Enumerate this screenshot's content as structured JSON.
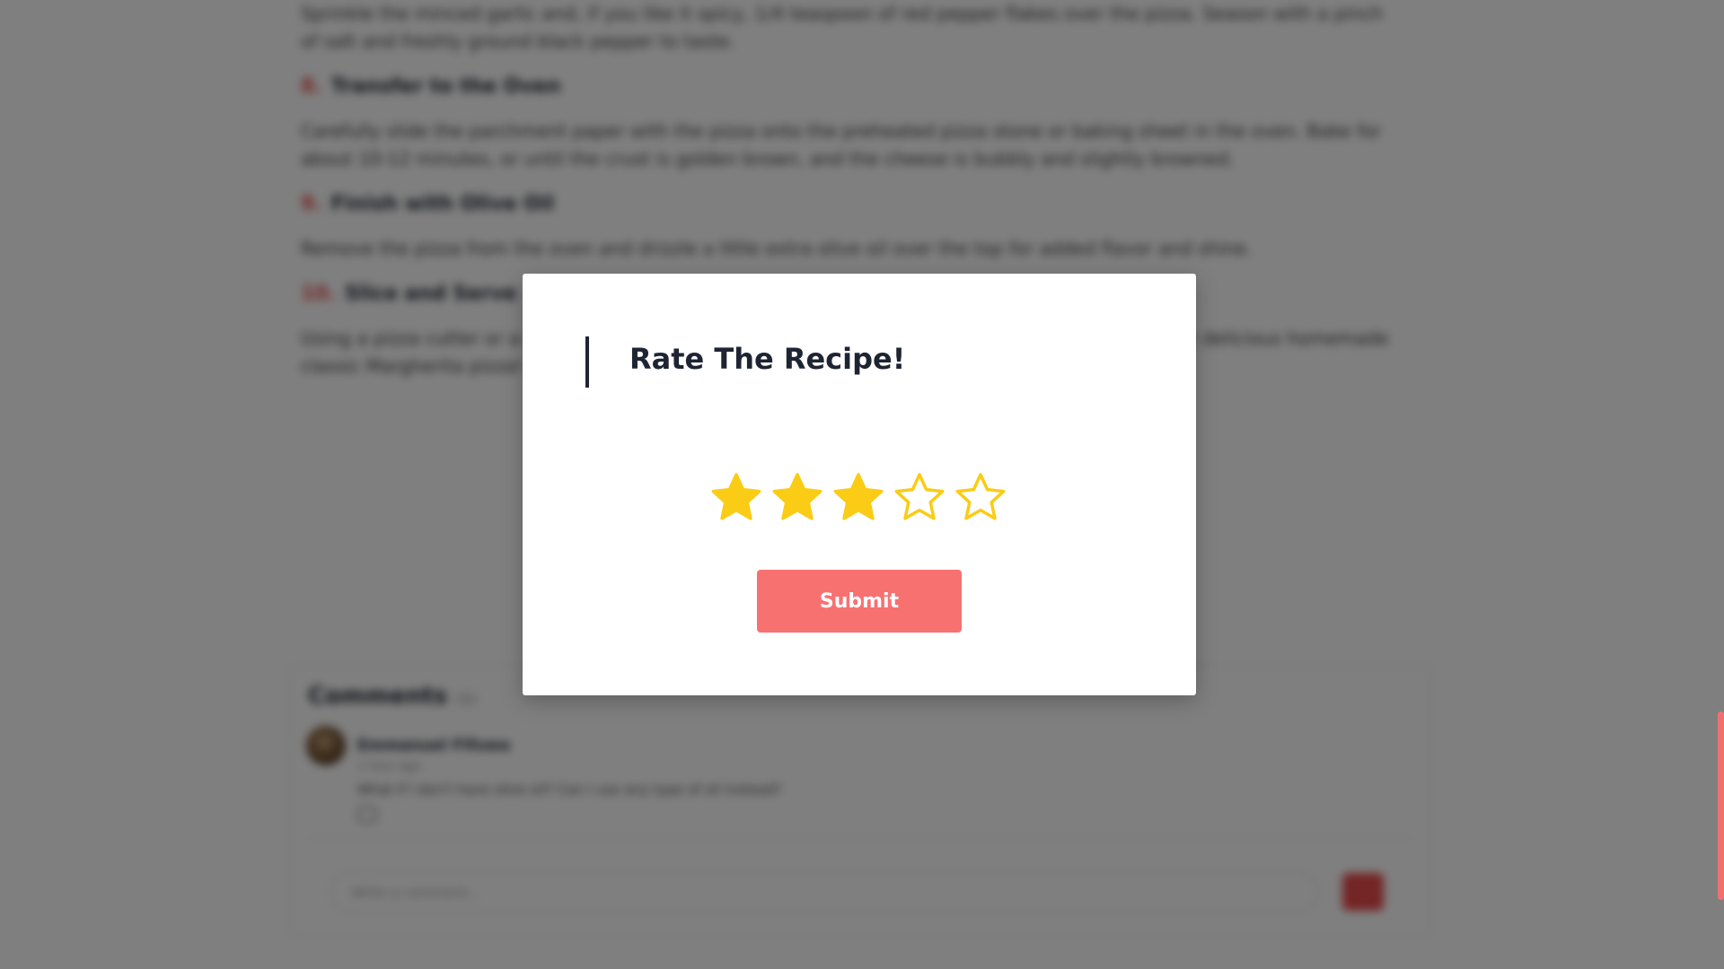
{
  "article": {
    "paragraphs": [
      {
        "type": "text",
        "text": "Sprinkle the minced garlic and, if you like it spicy, 1/4 teaspoon of red pepper flakes over the pizza. Season with a pinch of salt and freshly ground black pepper to taste."
      },
      {
        "type": "step",
        "num": "8.",
        "title": "Transfer to the Oven"
      },
      {
        "type": "text",
        "text": "Carefully slide the parchment paper with the pizza onto the preheated pizza stone or baking sheet in the oven. Bake for about 10-12 minutes, or until the crust is golden brown, and the cheese is bubbly and slightly browned."
      },
      {
        "type": "step",
        "num": "9.",
        "title": "Finish with Olive Oil"
      },
      {
        "type": "text",
        "text": "Remove the pizza from the oven and drizzle a little extra olive oil over the top for added flavor and shine."
      },
      {
        "type": "step",
        "num": "10.",
        "title": "Slice and Serve"
      },
      {
        "type": "text",
        "text": "Using a pizza cutter or a sharp knife, slice the pizza into wedges and serve immediately. Enjoy your delicious homemade classic Margherita pizza!"
      }
    ]
  },
  "comments": {
    "title": "Comments",
    "count": "(1)",
    "items": [
      {
        "name": "Emmanuel Fifuwa",
        "time": "1 hour ago",
        "text": "What if I don't have olive oil? Can I use any type of oil instead?"
      }
    ],
    "input_placeholder": "Write a comment..."
  },
  "modal": {
    "title": "Rate The Recipe!",
    "rating": 3,
    "max_rating": 5,
    "submit_label": "Submit",
    "star_color": "#FACC15",
    "submit_color": "#F87171"
  },
  "icons": {
    "star": "star-icon",
    "send": "send-icon",
    "reply": "reply-icon"
  }
}
